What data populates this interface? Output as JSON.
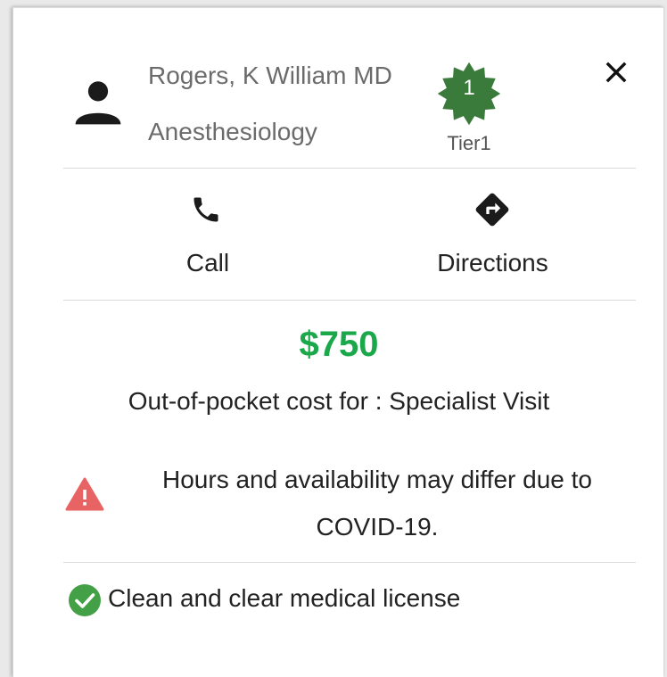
{
  "provider": {
    "name": "Rogers, K William MD",
    "specialty": "Anesthesiology",
    "tier_number": "1",
    "tier_label": "Tier1",
    "avatar_icon": "person-icon",
    "badge_icon": "seal-badge-icon"
  },
  "header": {
    "close_icon": "close-icon"
  },
  "actions": {
    "call_label": "Call",
    "call_icon": "phone-icon",
    "directions_label": "Directions",
    "directions_icon": "directions-icon"
  },
  "cost": {
    "amount": "$750",
    "description": "Out-of-pocket cost for : Specialist Visit"
  },
  "notices": {
    "covid": "Hours and availability may differ due to COVID-19.",
    "warning_icon": "warning-icon",
    "license": "Clean and clear medical license",
    "license_icon": "check-circle-icon"
  },
  "colors": {
    "badge_green": "#3a7a3a",
    "cost_green": "#1aa84b",
    "warning_red": "#e86464",
    "check_green": "#43a047",
    "text_primary": "#222222",
    "text_secondary": "#6b6b6b"
  }
}
